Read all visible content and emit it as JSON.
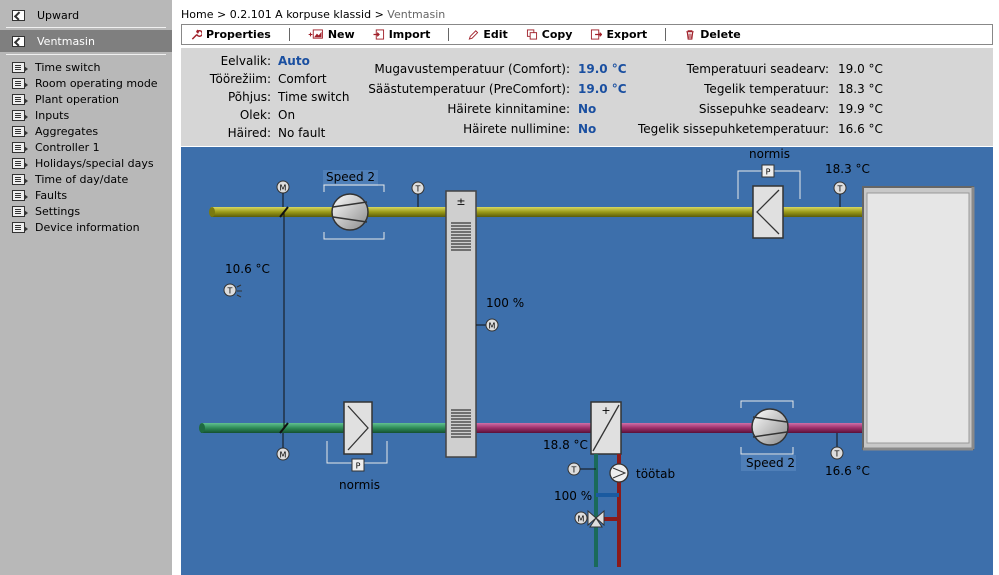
{
  "sidebar": {
    "upward": "Upward",
    "current": "Ventmasin",
    "items": [
      "Time switch",
      "Room operating mode",
      "Plant operation",
      "Inputs",
      "Aggregates",
      "Controller 1",
      "Holidays/special days",
      "Time of day/date",
      "Faults",
      "Settings",
      "Device information"
    ]
  },
  "breadcrumb": {
    "home": "Home",
    "sep": ">",
    "device": "0.2.101 A korpuse klassid",
    "current": "Ventmasin"
  },
  "toolbar": {
    "properties": "Properties",
    "new": "New",
    "import": "Import",
    "edit": "Edit",
    "copy": "Copy",
    "export": "Export",
    "delete": "Delete"
  },
  "info": {
    "col1": [
      {
        "label": "Eelvalik:",
        "value": "Auto",
        "highlight": true
      },
      {
        "label": "Töörežiim:",
        "value": "Comfort",
        "highlight": false
      },
      {
        "label": "Põhjus:",
        "value": "Time switch",
        "highlight": false
      },
      {
        "label": "Olek:",
        "value": "On",
        "highlight": false
      },
      {
        "label": "Häired:",
        "value": "No fault",
        "highlight": false
      }
    ],
    "col2": [
      {
        "label": "Mugavustemperatuur (Comfort):",
        "value": "19.0 °C"
      },
      {
        "label": "Säästutemperatuur (PreComfort):",
        "value": "19.0 °C"
      },
      {
        "label": "Häirete kinnitamine:",
        "value": "No"
      },
      {
        "label": "Häirete nullimine:",
        "value": "No"
      }
    ],
    "col3": [
      {
        "label": "Temperatuuri seadearv:",
        "value": "19.0 °C"
      },
      {
        "label": "Tegelik temperatuur:",
        "value": "18.3 °C"
      },
      {
        "label": "Sissepuhke seadearv:",
        "value": "19.9 °C"
      },
      {
        "label": "Tegelik sissepuhketemperatuur:",
        "value": "16.6 °C"
      }
    ]
  },
  "diagram": {
    "supply_fan_label": "Speed 2",
    "extract_fan_label": "Speed 2",
    "filter_top_label": "normis",
    "filter_bottom_label": "normis",
    "room_temp": "18.3 °C",
    "supply_temp": "16.6 °C",
    "outdoor_temp": "10.6 °C",
    "recovery_pct": "100 %",
    "heater_temp": "18.8 °C",
    "valve_pct": "100 %",
    "pump_status": "töötab",
    "icons": {
      "motor": "M",
      "temp": "T",
      "pressure": "P",
      "plusminus": "±"
    }
  },
  "colors": {
    "sidebar_bg": "#b8b8b8",
    "sidebar_selected": "#7f7f7f",
    "panel_bg": "#d6d6d6",
    "diagram_bg": "#3d6fab",
    "value_blue": "#1a4fa0",
    "supply_duct": "#a0a020",
    "extract_duct": "#2e8b57",
    "exhaust_duct": "#9c2f6a"
  }
}
